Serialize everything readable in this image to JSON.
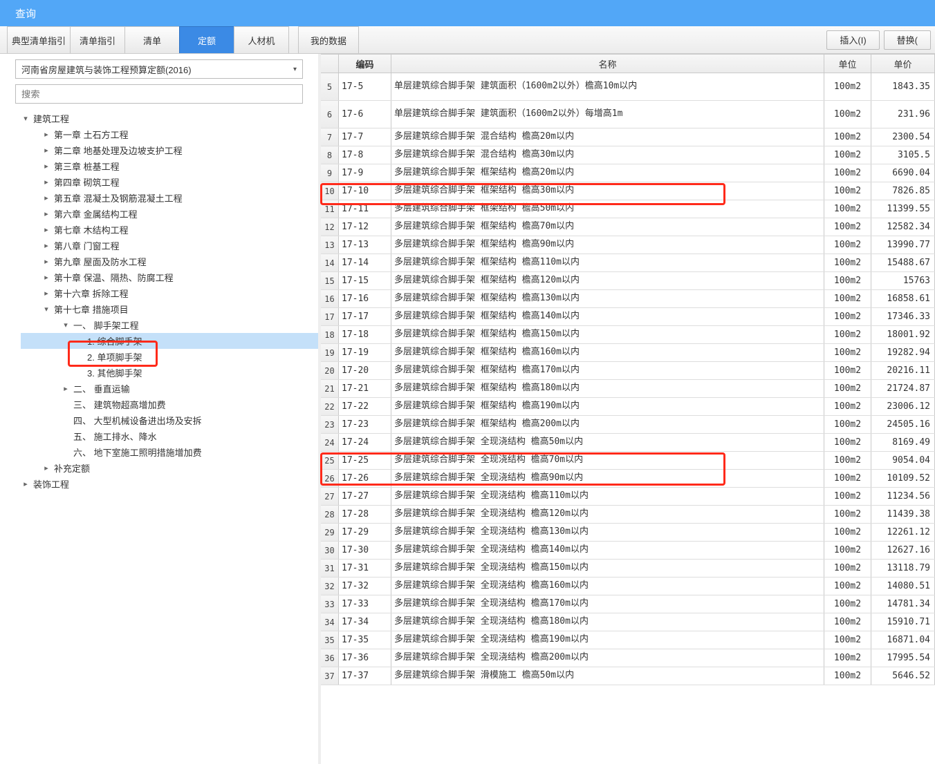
{
  "title": "查询",
  "tabs": [
    "典型清单指引",
    "清单指引",
    "清单",
    "定额",
    "人材机"
  ],
  "tab_mydata": "我的数据",
  "active_tab_index": 3,
  "btn_insert": "插入(I)",
  "btn_replace": "替换(",
  "select_value": "河南省房屋建筑与装饰工程预算定额(2016)",
  "search_placeholder": "搜索",
  "tree": [
    {
      "depth": 1,
      "toggle": "▾",
      "label": "建筑工程"
    },
    {
      "depth": 2,
      "toggle": "▸",
      "label": "第一章 土石方工程"
    },
    {
      "depth": 2,
      "toggle": "▸",
      "label": "第二章 地基处理及边坡支护工程"
    },
    {
      "depth": 2,
      "toggle": "▸",
      "label": "第三章 桩基工程"
    },
    {
      "depth": 2,
      "toggle": "▸",
      "label": "第四章 砌筑工程"
    },
    {
      "depth": 2,
      "toggle": "▸",
      "label": "第五章 混凝土及钢筋混凝土工程"
    },
    {
      "depth": 2,
      "toggle": "▸",
      "label": "第六章 金属结构工程"
    },
    {
      "depth": 2,
      "toggle": "▸",
      "label": "第七章 木结构工程"
    },
    {
      "depth": 2,
      "toggle": "▸",
      "label": "第八章 门窗工程"
    },
    {
      "depth": 2,
      "toggle": "▸",
      "label": "第九章 屋面及防水工程"
    },
    {
      "depth": 2,
      "toggle": "▸",
      "label": "第十章 保温、隔热、防腐工程"
    },
    {
      "depth": 2,
      "toggle": "▸",
      "label": "第十六章 拆除工程"
    },
    {
      "depth": 2,
      "toggle": "▾",
      "label": "第十七章 措施项目"
    },
    {
      "depth": 3,
      "toggle": "▾",
      "label": "一、 脚手架工程"
    },
    {
      "depth": 4,
      "toggle": "",
      "label": "1. 综合脚手架",
      "selected": true
    },
    {
      "depth": 4,
      "toggle": "",
      "label": "2. 单项脚手架"
    },
    {
      "depth": 4,
      "toggle": "",
      "label": "3. 其他脚手架"
    },
    {
      "depth": 3,
      "toggle": "▸",
      "label": "二、 垂直运输"
    },
    {
      "depth": 3,
      "toggle": "",
      "label": "三、 建筑物超高增加费"
    },
    {
      "depth": 3,
      "toggle": "",
      "label": "四、 大型机械设备进出场及安拆"
    },
    {
      "depth": 3,
      "toggle": "",
      "label": "五、 施工排水、降水"
    },
    {
      "depth": 3,
      "toggle": "",
      "label": "六、 地下室施工照明措施增加费"
    },
    {
      "depth": 2,
      "toggle": "▸",
      "label": "补充定额"
    },
    {
      "depth": 1,
      "toggle": "▸",
      "label": "装饰工程"
    }
  ],
  "grid_headers": {
    "code": "编码",
    "name": "名称",
    "unit": "单位",
    "price": "单价"
  },
  "rows": [
    {
      "idx": "5",
      "code": "17-5",
      "name": "单层建筑综合脚手架 建筑面积（1600m2以外）檐高10m以内",
      "unit": "100m2",
      "price": "1843.35",
      "tall": true
    },
    {
      "idx": "6",
      "code": "17-6",
      "name": "单层建筑综合脚手架 建筑面积（1600m2以外）每增高1m",
      "unit": "100m2",
      "price": "231.96",
      "tall": true
    },
    {
      "idx": "7",
      "code": "17-7",
      "name": "多层建筑综合脚手架 混合结构 檐高20m以内",
      "unit": "100m2",
      "price": "2300.54"
    },
    {
      "idx": "8",
      "code": "17-8",
      "name": "多层建筑综合脚手架 混合结构 檐高30m以内",
      "unit": "100m2",
      "price": "3105.5"
    },
    {
      "idx": "9",
      "code": "17-9",
      "name": "多层建筑综合脚手架 框架结构 檐高20m以内",
      "unit": "100m2",
      "price": "6690.04"
    },
    {
      "idx": "10",
      "code": "17-10",
      "name": "多层建筑综合脚手架 框架结构 檐高30m以内",
      "unit": "100m2",
      "price": "7826.85"
    },
    {
      "idx": "11",
      "code": "17-11",
      "name": "多层建筑综合脚手架 框架结构 檐高50m以内",
      "unit": "100m2",
      "price": "11399.55"
    },
    {
      "idx": "12",
      "code": "17-12",
      "name": "多层建筑综合脚手架 框架结构 檐高70m以内",
      "unit": "100m2",
      "price": "12582.34"
    },
    {
      "idx": "13",
      "code": "17-13",
      "name": "多层建筑综合脚手架 框架结构 檐高90m以内",
      "unit": "100m2",
      "price": "13990.77"
    },
    {
      "idx": "14",
      "code": "17-14",
      "name": "多层建筑综合脚手架 框架结构 檐高110m以内",
      "unit": "100m2",
      "price": "15488.67"
    },
    {
      "idx": "15",
      "code": "17-15",
      "name": "多层建筑综合脚手架 框架结构 檐高120m以内",
      "unit": "100m2",
      "price": "15763"
    },
    {
      "idx": "16",
      "code": "17-16",
      "name": "多层建筑综合脚手架 框架结构 檐高130m以内",
      "unit": "100m2",
      "price": "16858.61"
    },
    {
      "idx": "17",
      "code": "17-17",
      "name": "多层建筑综合脚手架 框架结构 檐高140m以内",
      "unit": "100m2",
      "price": "17346.33"
    },
    {
      "idx": "18",
      "code": "17-18",
      "name": "多层建筑综合脚手架 框架结构 檐高150m以内",
      "unit": "100m2",
      "price": "18001.92"
    },
    {
      "idx": "19",
      "code": "17-19",
      "name": "多层建筑综合脚手架 框架结构 檐高160m以内",
      "unit": "100m2",
      "price": "19282.94"
    },
    {
      "idx": "20",
      "code": "17-20",
      "name": "多层建筑综合脚手架 框架结构 檐高170m以内",
      "unit": "100m2",
      "price": "20216.11"
    },
    {
      "idx": "21",
      "code": "17-21",
      "name": "多层建筑综合脚手架 框架结构 檐高180m以内",
      "unit": "100m2",
      "price": "21724.87"
    },
    {
      "idx": "22",
      "code": "17-22",
      "name": "多层建筑综合脚手架 框架结构 檐高190m以内",
      "unit": "100m2",
      "price": "23006.12"
    },
    {
      "idx": "23",
      "code": "17-23",
      "name": "多层建筑综合脚手架 框架结构 檐高200m以内",
      "unit": "100m2",
      "price": "24505.16"
    },
    {
      "idx": "24",
      "code": "17-24",
      "name": "多层建筑综合脚手架 全现浇结构 檐高50m以内",
      "unit": "100m2",
      "price": "8169.49"
    },
    {
      "idx": "25",
      "code": "17-25",
      "name": "多层建筑综合脚手架 全现浇结构 檐高70m以内",
      "unit": "100m2",
      "price": "9054.04"
    },
    {
      "idx": "26",
      "code": "17-26",
      "name": "多层建筑综合脚手架 全现浇结构 檐高90m以内",
      "unit": "100m2",
      "price": "10109.52"
    },
    {
      "idx": "27",
      "code": "17-27",
      "name": "多层建筑综合脚手架 全现浇结构 檐高110m以内",
      "unit": "100m2",
      "price": "11234.56"
    },
    {
      "idx": "28",
      "code": "17-28",
      "name": "多层建筑综合脚手架 全现浇结构 檐高120m以内",
      "unit": "100m2",
      "price": "11439.38"
    },
    {
      "idx": "29",
      "code": "17-29",
      "name": "多层建筑综合脚手架 全现浇结构 檐高130m以内",
      "unit": "100m2",
      "price": "12261.12"
    },
    {
      "idx": "30",
      "code": "17-30",
      "name": "多层建筑综合脚手架 全现浇结构 檐高140m以内",
      "unit": "100m2",
      "price": "12627.16"
    },
    {
      "idx": "31",
      "code": "17-31",
      "name": "多层建筑综合脚手架 全现浇结构 檐高150m以内",
      "unit": "100m2",
      "price": "13118.79"
    },
    {
      "idx": "32",
      "code": "17-32",
      "name": "多层建筑综合脚手架 全现浇结构 檐高160m以内",
      "unit": "100m2",
      "price": "14080.51"
    },
    {
      "idx": "33",
      "code": "17-33",
      "name": "多层建筑综合脚手架 全现浇结构 檐高170m以内",
      "unit": "100m2",
      "price": "14781.34"
    },
    {
      "idx": "34",
      "code": "17-34",
      "name": "多层建筑综合脚手架 全现浇结构 檐高180m以内",
      "unit": "100m2",
      "price": "15910.71"
    },
    {
      "idx": "35",
      "code": "17-35",
      "name": "多层建筑综合脚手架 全现浇结构 檐高190m以内",
      "unit": "100m2",
      "price": "16871.04"
    },
    {
      "idx": "36",
      "code": "17-36",
      "name": "多层建筑综合脚手架 全现浇结构 檐高200m以内",
      "unit": "100m2",
      "price": "17995.54"
    },
    {
      "idx": "37",
      "code": "17-37",
      "name": "多层建筑综合脚手架 滑模施工 檐高50m以内",
      "unit": "100m2",
      "price": "5646.52"
    }
  ]
}
